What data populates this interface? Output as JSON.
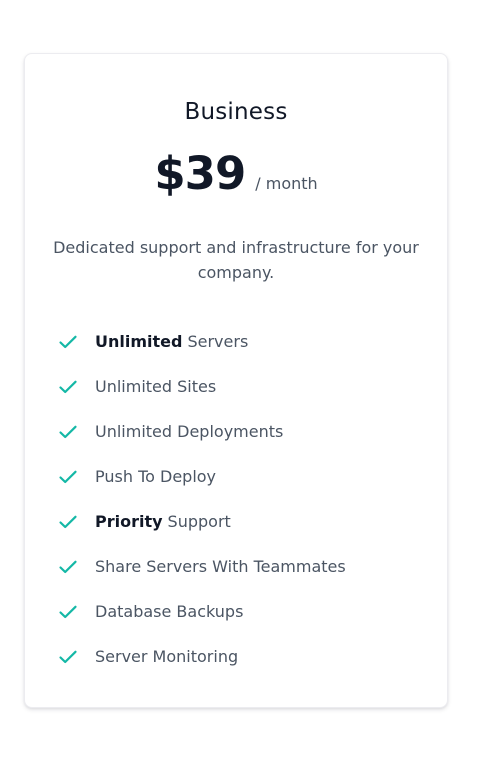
{
  "plan": {
    "name": "Business",
    "price": "$39",
    "period": "/ month",
    "description": "Dedicated support and infrastructure for your company.",
    "accent_color": "#14b8a6"
  },
  "features": [
    {
      "bold": "Unlimited",
      "text": "Servers"
    },
    {
      "bold": "",
      "text": "Unlimited Sites"
    },
    {
      "bold": "",
      "text": "Unlimited Deployments"
    },
    {
      "bold": "",
      "text": "Push To Deploy"
    },
    {
      "bold": "Priority",
      "text": "Support"
    },
    {
      "bold": "",
      "text": "Share Servers With Teammates"
    },
    {
      "bold": "",
      "text": "Database Backups"
    },
    {
      "bold": "",
      "text": "Server Monitoring"
    }
  ],
  "icons": {
    "feature": "check-icon"
  }
}
